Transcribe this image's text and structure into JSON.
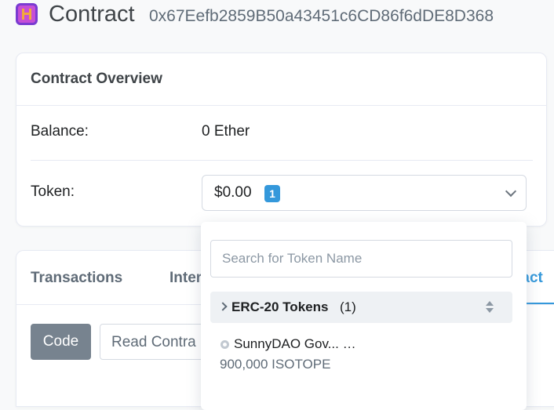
{
  "header": {
    "logo_icon": "sunnydao-token-logo",
    "title": "Contract",
    "address": "0x67Eefb2859B50a43451c6CD86f6dDE8D368"
  },
  "overview": {
    "title": "Contract Overview",
    "balance_label": "Balance:",
    "balance_value": "0 Ether",
    "token_label": "Token:",
    "token_value": "$0.00",
    "token_count": "1"
  },
  "tabs": {
    "items": [
      "Transactions",
      "Inter",
      "ract"
    ],
    "active_index": 2,
    "code_label": "Code",
    "read_label": "Read Contra"
  },
  "dropdown": {
    "search_placeholder": "Search for Token Name",
    "group_title": "ERC-20 Tokens",
    "group_count": "(1)",
    "token_name": "SunnyDAO Gov... …",
    "token_amount": "900,000 ISOTOPE"
  },
  "colors": {
    "accent": "#3498db",
    "code_button": "#77838f"
  }
}
